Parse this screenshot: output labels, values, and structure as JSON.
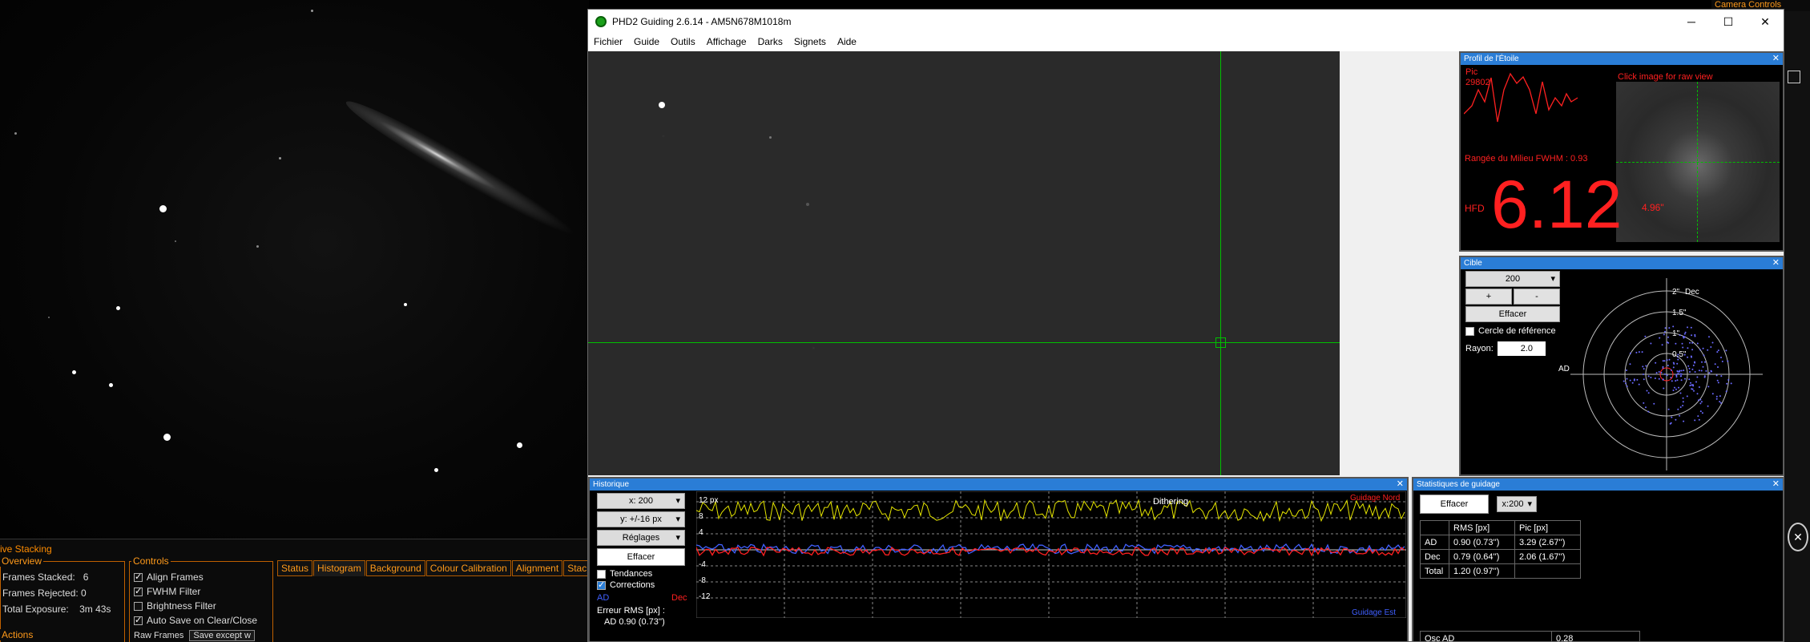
{
  "stacking": {
    "section_title": "ive Stacking",
    "overview_label": "Overview",
    "frames_stacked_label": "Frames Stacked:",
    "frames_stacked": "6",
    "frames_rejected_label": "Frames Rejected:",
    "frames_rejected": "0",
    "total_exposure_label": "Total Exposure:",
    "total_exposure": "3m 43s",
    "controls_label": "Controls",
    "align_frames": "Align Frames",
    "fwhm_filter": "FWHM Filter",
    "brightness_filter": "Brightness Filter",
    "auto_save": "Auto Save on Clear/Close",
    "raw_frames_label": "Raw Frames",
    "raw_frames_value": "Save except w",
    "actions_label": "Actions",
    "tabs": [
      "Status",
      "Histogram",
      "Background",
      "Colour Calibration",
      "Alignment",
      "Stac"
    ]
  },
  "camera_controls_label": "Camera Controls",
  "phd": {
    "title": "PHD2 Guiding 2.6.14 - AM5N678M1018m",
    "menus": [
      "Fichier",
      "Guide",
      "Outils",
      "Affichage",
      "Darks",
      "Signets",
      "Aide"
    ],
    "window_controls": {
      "min": "─",
      "max": "☐",
      "close": "✕"
    }
  },
  "profile": {
    "title": "Profil de l'Étoile",
    "pic_label": "Pic",
    "pic_value": "29802",
    "click_hint": "Click image for raw view",
    "mid_row": "Rangée du Milieu FWHM : 0.93",
    "hfd_label": "HFD",
    "hfd_value": "6.12",
    "hfd_arcsec": "4.96\""
  },
  "target": {
    "title": "Cible",
    "scale": "200",
    "plus": "+",
    "minus": "-",
    "clear": "Effacer",
    "ref_circle": "Cercle de référence",
    "radius_label": "Rayon:",
    "radius_value": "2.0",
    "ring_labels": [
      "2\"",
      "1.5\"",
      "1\"",
      "0.5\""
    ],
    "dec_label": "Dec",
    "ra_label": "AD"
  },
  "history": {
    "title": "Historique",
    "x_scale": "x: 200",
    "y_scale": "y: +/-16 px",
    "settings": "Réglages",
    "clear": "Effacer",
    "trends": "Tendances",
    "corrections": "Corrections",
    "ra_label": "AD",
    "dec_label": "Dec",
    "rms_label": "Erreur RMS [px] :",
    "rms_value": "AD 0.90 (0.73'')",
    "y_ticks": [
      "12 px",
      "8",
      "4",
      "-4",
      "-8",
      "-12"
    ],
    "dithering": "Dithering",
    "guide_north": "Guidage Nord",
    "guide_east": "Guidage Est"
  },
  "stats": {
    "title": "Statistiques de guidage",
    "clear": "Effacer",
    "scale": "x:200",
    "headers": [
      "",
      "RMS [px]",
      "Pic [px]"
    ],
    "rows": [
      [
        "AD",
        "0.90 (0.73'')",
        "3.29 (2.67'')"
      ],
      [
        "Dec",
        "0.79 (0.64'')",
        "2.06 (1.67'')"
      ],
      [
        "Total",
        "1.20 (0.97'')",
        ""
      ]
    ],
    "osc_label": "Osc AD",
    "osc_value": "0.28"
  },
  "colors": {
    "accent_orange": "#ff9a1a",
    "pane_blue": "#2a7dd6",
    "ra_blue": "#4060ff",
    "dec_red": "#ff2020",
    "trace_yellow": "#e6e600",
    "crosshair_green": "#00c000"
  }
}
